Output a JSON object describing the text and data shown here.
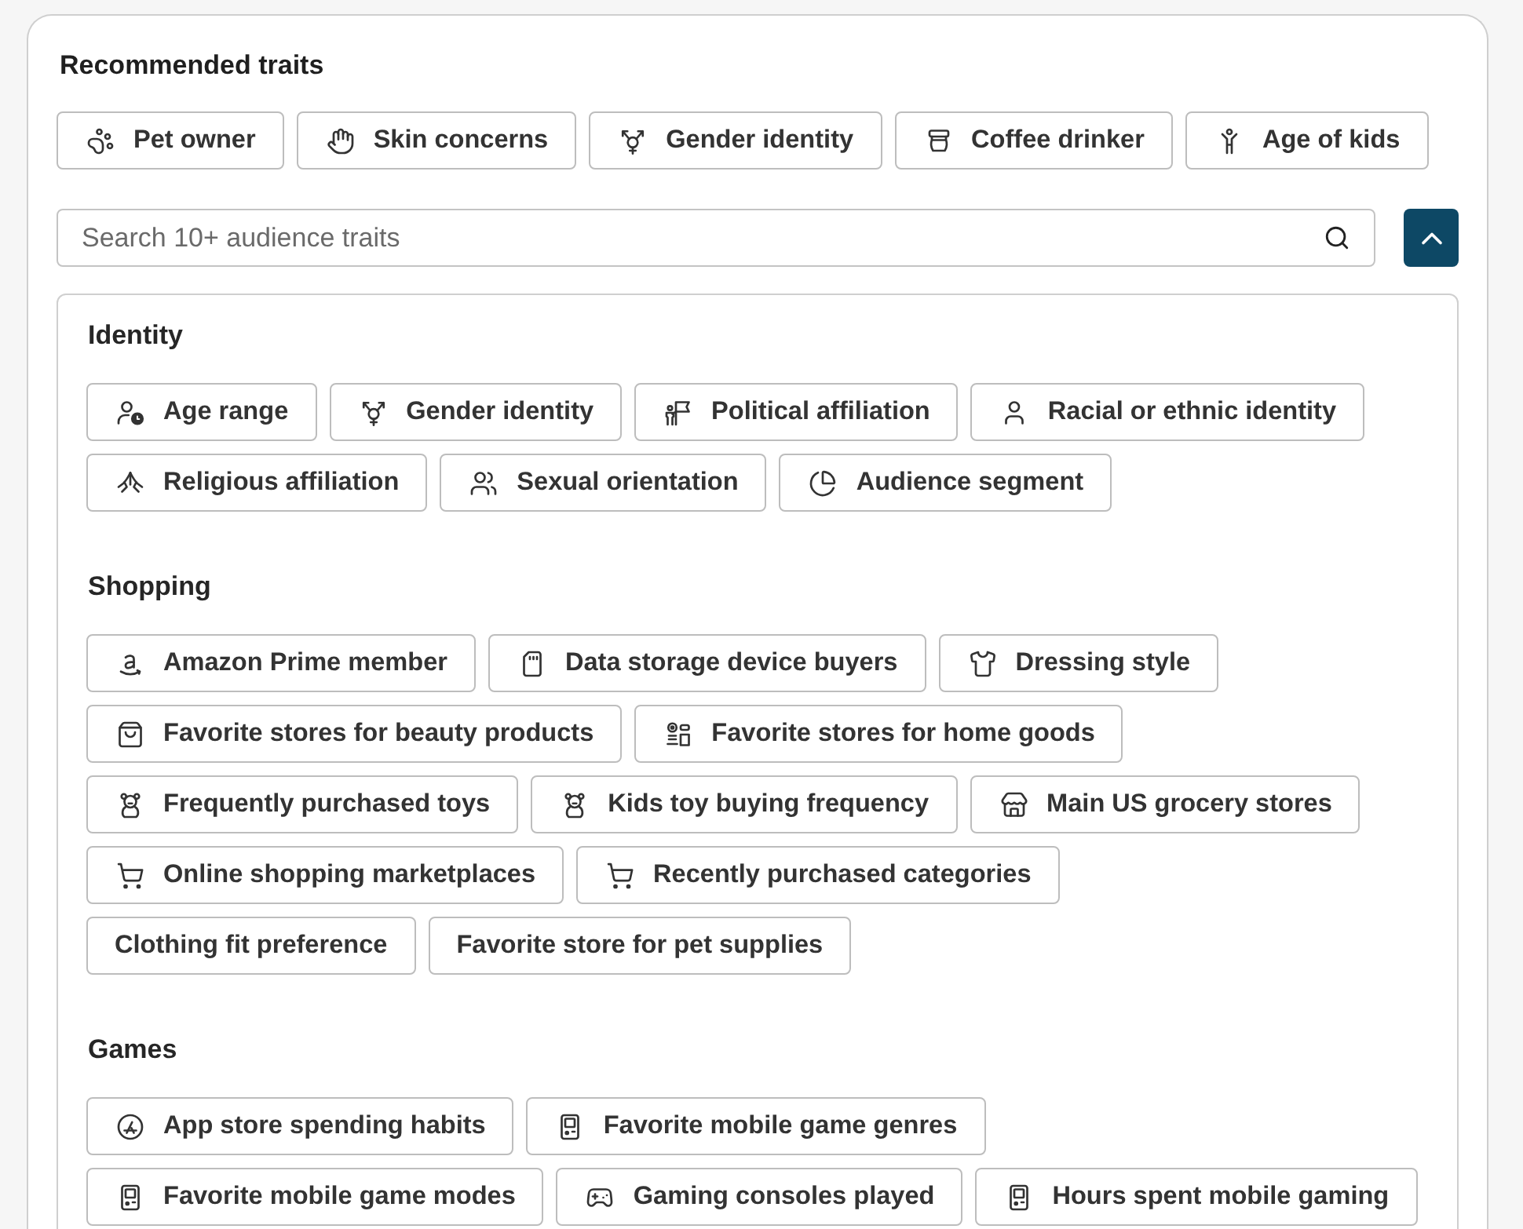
{
  "recommended": {
    "title": "Recommended traits",
    "traits": [
      "Pet owner",
      "Skin concerns",
      "Gender identity",
      "Coffee drinker",
      "Age of kids"
    ]
  },
  "search": {
    "placeholder": "Search 10+ audience traits"
  },
  "collapse_button": {
    "expanded": true
  },
  "categories": [
    {
      "title": "Identity",
      "traits": [
        "Age range",
        "Gender identity",
        "Political affiliation",
        "Racial or ethnic identity",
        "Religious affiliation",
        "Sexual orientation",
        "Audience segment"
      ]
    },
    {
      "title": "Shopping",
      "traits": [
        "Amazon Prime member",
        "Data storage device buyers",
        "Dressing style",
        "Favorite stores for beauty products",
        "Favorite stores for home goods",
        "Frequently purchased toys",
        "Kids toy buying frequency",
        "Main US grocery stores",
        "Online shopping marketplaces",
        "Recently purchased categories",
        "Clothing fit preference",
        "Favorite store for pet supplies"
      ]
    },
    {
      "title": "Games",
      "traits": [
        "App store spending habits",
        "Favorite mobile game genres",
        "Favorite mobile game modes",
        "Gaming consoles played",
        "Hours spent mobile gaming"
      ]
    }
  ]
}
